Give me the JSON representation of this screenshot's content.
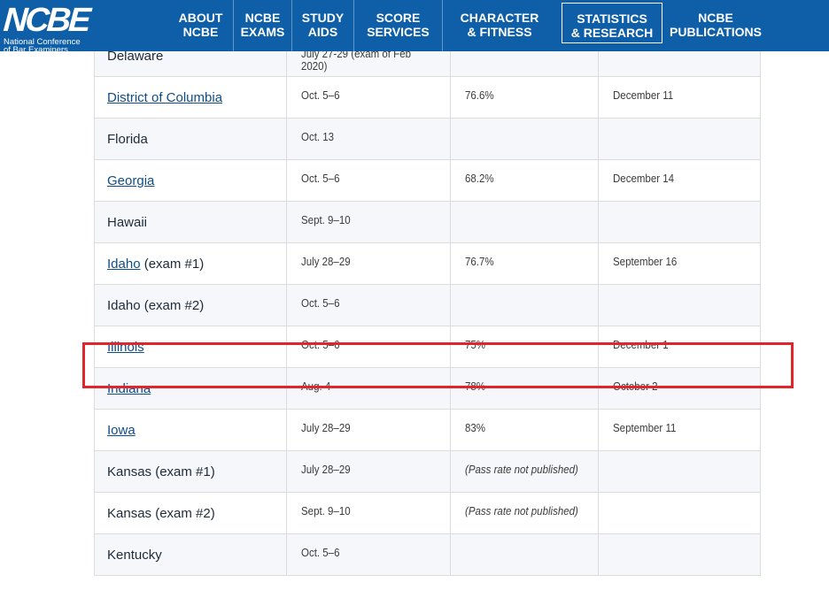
{
  "header": {
    "logo_text": "NCBE",
    "logo_sub_1": "National Conference",
    "logo_sub_2": "of Bar Examiners",
    "nav": [
      {
        "line1": "ABOUT",
        "line2": "NCBE"
      },
      {
        "line1": "NCBE",
        "line2": "EXAMS"
      },
      {
        "line1": "STUDY",
        "line2": "AIDS"
      },
      {
        "line1": "SCORE",
        "line2": "SERVICES"
      },
      {
        "line1": "CHARACTER",
        "line2": "& FITNESS"
      },
      {
        "line1": "STATISTICS",
        "line2": "& RESEARCH",
        "active": true
      },
      {
        "line1": "NCBE",
        "line2": "PUBLICATIONS"
      }
    ]
  },
  "table": {
    "partial_row": {
      "jurisdiction": "Delaware",
      "date": "July 27-29 (exam of Feb 2020)"
    },
    "rows": [
      {
        "jurisdiction": "District of Columbia",
        "linked": true,
        "suffix": "",
        "date": "Oct. 5–6",
        "pass_rate": "76.6%",
        "release": "December 11"
      },
      {
        "jurisdiction": "Florida",
        "linked": false,
        "suffix": "",
        "date": "Oct. 13",
        "pass_rate": "",
        "release": ""
      },
      {
        "jurisdiction": "Georgia",
        "linked": true,
        "suffix": "",
        "date": "Oct. 5–6",
        "pass_rate": "68.2%",
        "release": "December 14"
      },
      {
        "jurisdiction": "Hawaii",
        "linked": false,
        "suffix": "",
        "date": "Sept. 9–10",
        "pass_rate": "",
        "release": ""
      },
      {
        "jurisdiction": "Idaho",
        "linked": true,
        "suffix": " (exam #1)",
        "date": "July 28–29",
        "pass_rate": "76.7%",
        "release": "September 16"
      },
      {
        "jurisdiction": "Idaho (exam #2)",
        "linked": false,
        "suffix": "",
        "date": "Oct. 5–6",
        "pass_rate": "",
        "release": ""
      },
      {
        "jurisdiction": "Illinois",
        "linked": true,
        "suffix": "",
        "date": "Oct. 5–6",
        "pass_rate": "75%",
        "release": "December 1"
      },
      {
        "jurisdiction": "Indiana",
        "linked": true,
        "suffix": "",
        "date": "Aug. 4",
        "pass_rate": "78%",
        "release": "October 2"
      },
      {
        "jurisdiction": "Iowa",
        "linked": true,
        "suffix": "",
        "date": "July 28–29",
        "pass_rate": "83%",
        "release": "September 11"
      },
      {
        "jurisdiction": "Kansas (exam #1)",
        "linked": false,
        "suffix": "",
        "date": "July 28–29",
        "pass_rate": "(Pass rate not published)",
        "release": ""
      },
      {
        "jurisdiction": "Kansas (exam #2)",
        "linked": false,
        "suffix": "",
        "date": "Sept. 9–10",
        "pass_rate": "(Pass rate not published)",
        "release": ""
      },
      {
        "jurisdiction": "Kentucky",
        "linked": false,
        "suffix": "",
        "date": "Oct. 5–6",
        "pass_rate": "",
        "release": ""
      }
    ]
  },
  "colors": {
    "header_bg": "#0f5fa8",
    "link": "#0f4d8a",
    "highlight": "#e0252b"
  }
}
